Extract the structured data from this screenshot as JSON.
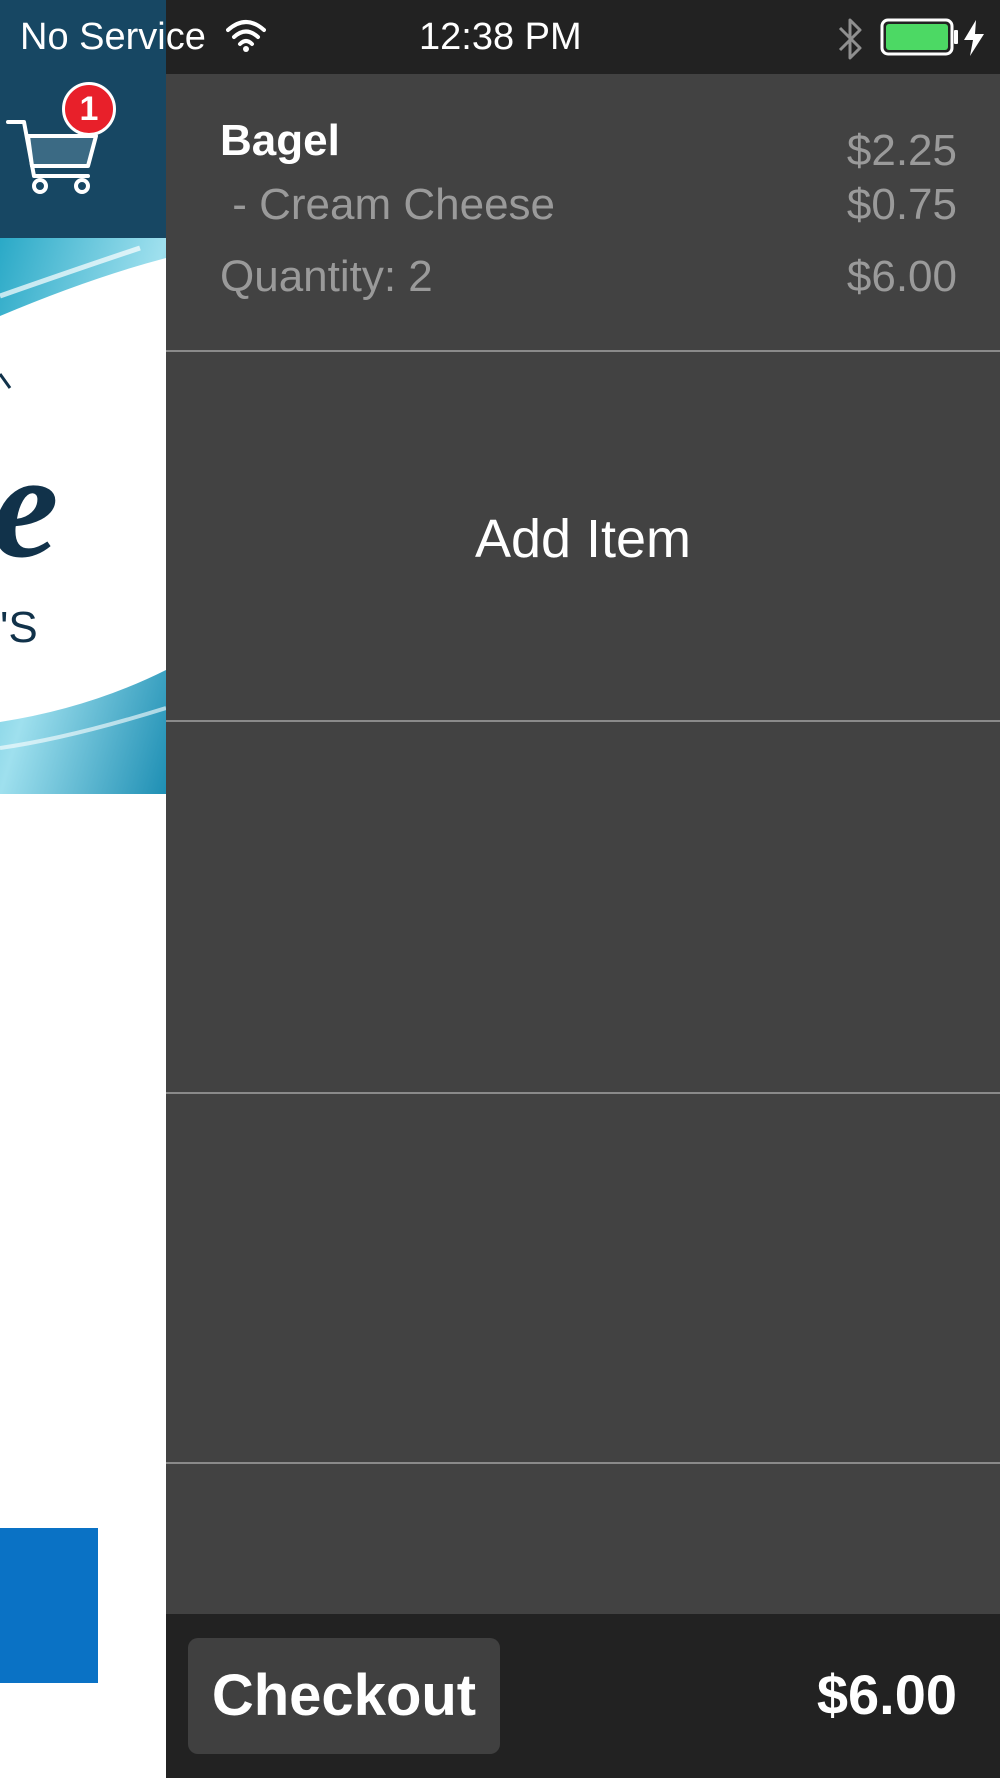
{
  "status_bar": {
    "carrier": "No Service",
    "time": "12:38 PM",
    "battery_level": 1.0,
    "charging": true
  },
  "background_app": {
    "cart_badge_count": "1",
    "colors": {
      "header": "#174763",
      "button": "#0a72c5",
      "badge": "#e8202a"
    }
  },
  "cart": {
    "items": [
      {
        "name": "Bagel",
        "price": "$2.25",
        "modifier": " - Cream Cheese",
        "modifier_price": "$0.75",
        "quantity_label": "Quantity: 2",
        "line_total": "$6.00"
      }
    ],
    "add_item_label": "Add Item",
    "checkout_label": "Checkout",
    "total": "$6.00"
  },
  "colors": {
    "panel_bg": "#424242",
    "bar_bg": "#222222",
    "divider": "#8a8a8a",
    "muted_text": "#9a9a9a"
  }
}
